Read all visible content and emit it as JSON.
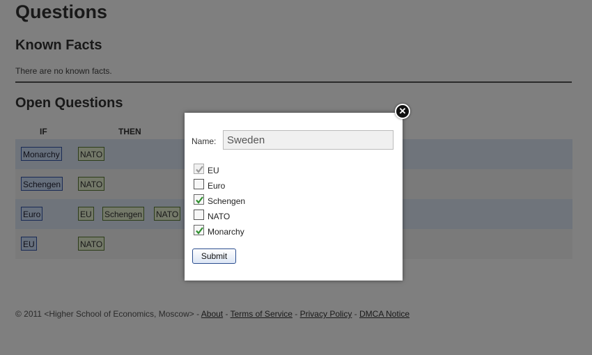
{
  "page": {
    "title": "Questions",
    "known_facts_heading": "Known Facts",
    "no_facts_text": "There are no known facts.",
    "open_questions_heading": "Open Questions"
  },
  "table": {
    "headers": {
      "if": "IF",
      "then": "THEN"
    },
    "rows": [
      {
        "if": [
          "Monarchy"
        ],
        "then": [
          "NATO"
        ]
      },
      {
        "if": [
          "Schengen"
        ],
        "then": [
          "NATO"
        ]
      },
      {
        "if": [
          "Euro"
        ],
        "then": [
          "EU",
          "Schengen",
          "NATO"
        ]
      },
      {
        "if": [
          "EU"
        ],
        "then": [
          "NATO"
        ]
      }
    ]
  },
  "footer": {
    "copyright": "© 2011 <Higher School of Economics, Moscow>",
    "links": [
      "About",
      "Terms of Service",
      "Privacy Policy",
      "DMCA Notice"
    ],
    "separator": "-"
  },
  "modal": {
    "name_label": "Name:",
    "name_value": "Sweden",
    "close_glyph": "✕",
    "submit_label": "Submit",
    "options": [
      {
        "label": "EU",
        "checked": true,
        "disabled": true
      },
      {
        "label": "Euro",
        "checked": false,
        "disabled": false
      },
      {
        "label": "Schengen",
        "checked": true,
        "disabled": false
      },
      {
        "label": "NATO",
        "checked": false,
        "disabled": false
      },
      {
        "label": "Monarchy",
        "checked": true,
        "disabled": false
      }
    ]
  },
  "colors": {
    "overlay": "rgba(0,0,0,0.5)",
    "if_tag_bg": "#cfe0fb",
    "then_tag_bg": "#e8f3d2",
    "check_green": "#2f8f2f",
    "check_disabled": "#999999"
  }
}
